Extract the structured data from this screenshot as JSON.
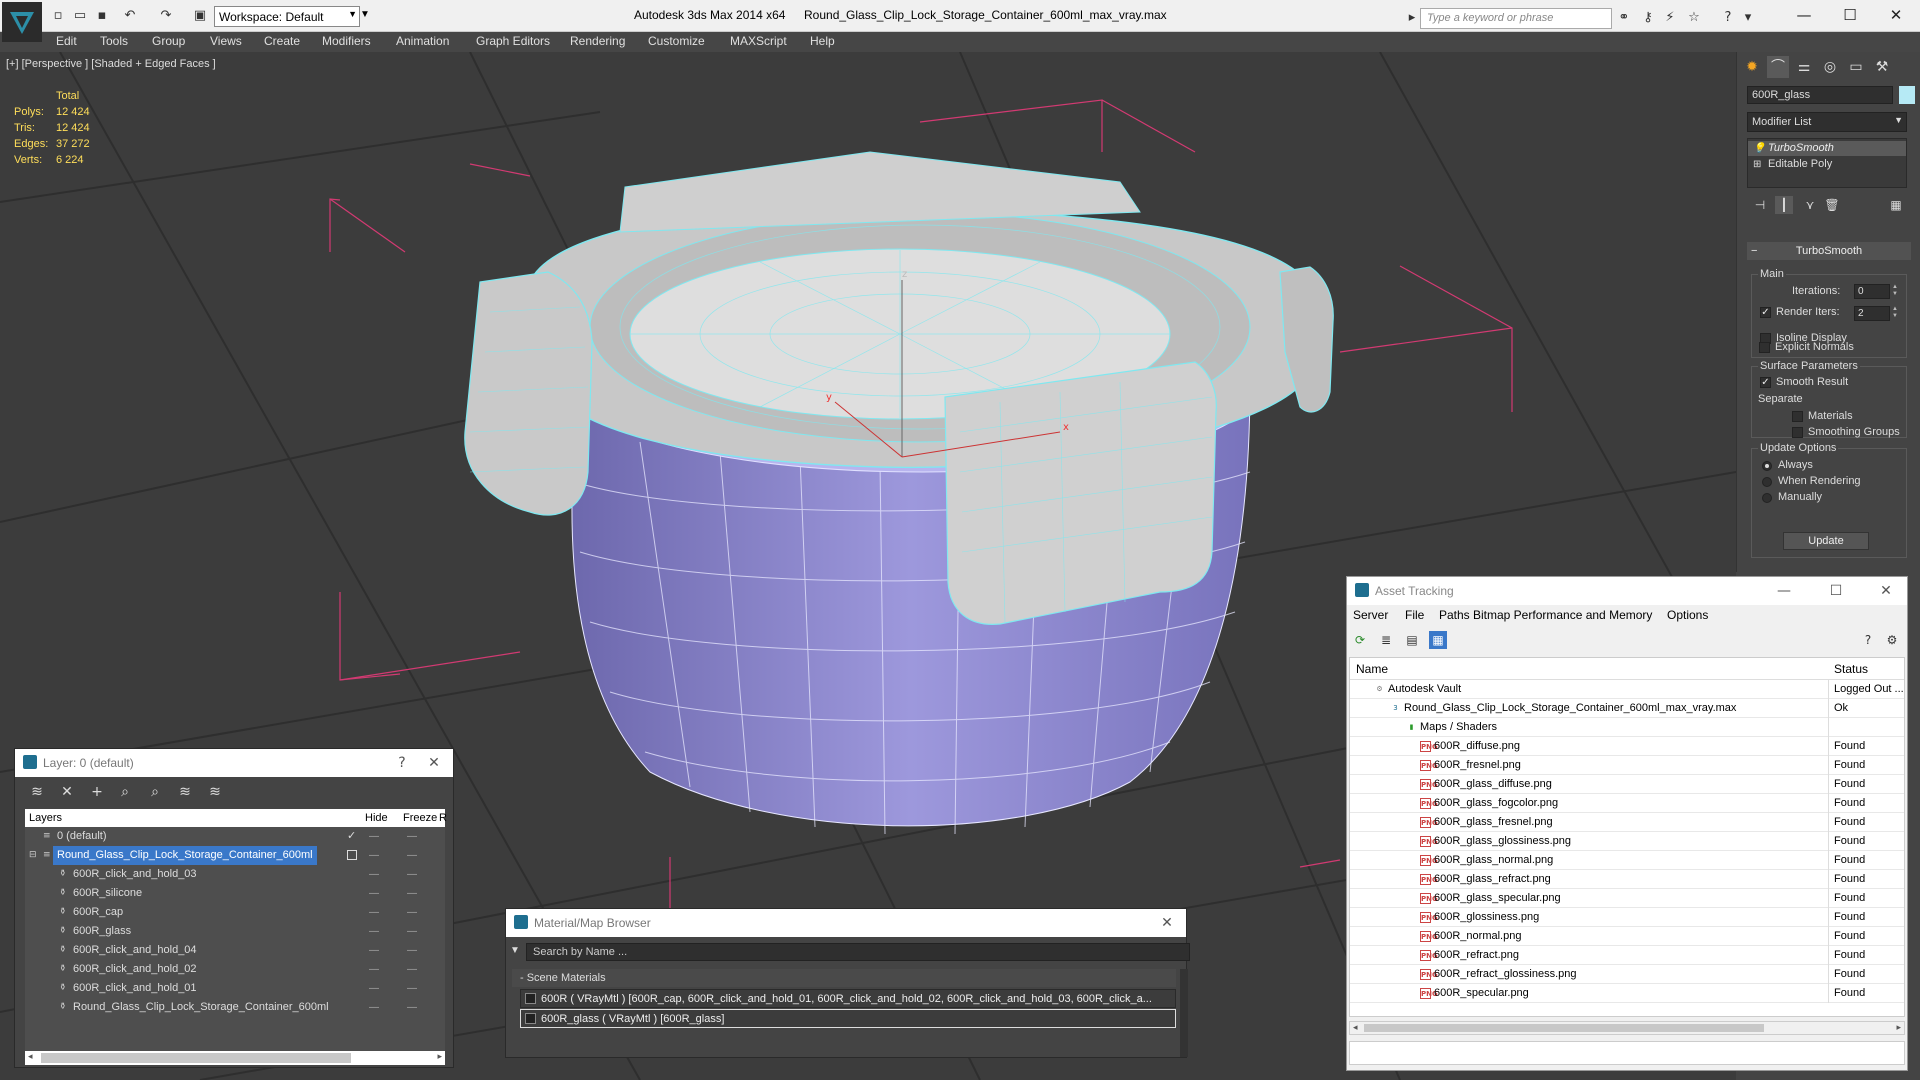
{
  "titlebar": {
    "workspace": "Workspace: Default",
    "app_title": "Autodesk 3ds Max  2014 x64",
    "file_title": "Round_Glass_Clip_Lock_Storage_Container_600ml_max_vray.max",
    "search_placeholder": "Type a keyword or phrase"
  },
  "menu": [
    "Edit",
    "Tools",
    "Group",
    "Views",
    "Create",
    "Modifiers",
    "Animation",
    "Graph Editors",
    "Rendering",
    "Customize",
    "MAXScript",
    "Help"
  ],
  "viewport": {
    "label": "[+] [Perspective ] [Shaded + Edged Faces ]",
    "stats": {
      "header": "Total",
      "rows": [
        {
          "label": "Polys:",
          "value": "12 424"
        },
        {
          "label": "Tris:",
          "value": "12 424"
        },
        {
          "label": "Edges:",
          "value": "37 272"
        },
        {
          "label": "Verts:",
          "value": "6 224"
        }
      ]
    },
    "axis_labels": {
      "z": "z",
      "y": "y",
      "x": "x"
    }
  },
  "command_panel": {
    "object_name": "600R_glass",
    "object_color": "#b6eaf5",
    "modifier_list": "Modifier List",
    "stack": [
      "TurboSmooth",
      "Editable Poly"
    ],
    "rollout_title": "TurboSmooth",
    "main_group": "Main",
    "iterations_label": "Iterations:",
    "iterations_value": "0",
    "render_iters_label": "Render Iters:",
    "render_iters_value": "2",
    "isoline_label": "Isoline Display",
    "explicit_normals_label": "Explicit Normals",
    "surface_group": "Surface Parameters",
    "smooth_result_label": "Smooth Result",
    "separate_label": "Separate",
    "materials_label": "Materials",
    "smoothing_groups_label": "Smoothing Groups",
    "update_group": "Update Options",
    "always_label": "Always",
    "when_rendering_label": "When Rendering",
    "manually_label": "Manually",
    "update_button": "Update"
  },
  "layer_dialog": {
    "title": "Layer: 0 (default)",
    "help": "?",
    "col_layers": "Layers",
    "col_hide": "Hide",
    "col_freeze": "Freeze",
    "col_r": "R",
    "rows": [
      {
        "name": "0 (default)",
        "indent": 0,
        "check": "✓"
      },
      {
        "name": "Round_Glass_Clip_Lock_Storage_Container_600ml",
        "indent": 0,
        "selected": true
      },
      {
        "name": "600R_click_and_hold_03",
        "indent": 1
      },
      {
        "name": "600R_silicone",
        "indent": 1
      },
      {
        "name": "600R_cap",
        "indent": 1
      },
      {
        "name": "600R_glass",
        "indent": 1
      },
      {
        "name": "600R_click_and_hold_04",
        "indent": 1
      },
      {
        "name": "600R_click_and_hold_02",
        "indent": 1
      },
      {
        "name": "600R_click_and_hold_01",
        "indent": 1
      },
      {
        "name": "Round_Glass_Clip_Lock_Storage_Container_600ml",
        "indent": 1
      }
    ]
  },
  "material_browser": {
    "title": "Material/Map Browser",
    "search_placeholder": "Search by Name ...",
    "group": "- Scene Materials",
    "rows": [
      "600R  ( VRayMtl )  [600R_cap, 600R_click_and_hold_01, 600R_click_and_hold_02, 600R_click_and_hold_03, 600R_click_a...",
      "600R_glass  ( VRayMtl )  [600R_glass]"
    ]
  },
  "asset_tracking": {
    "title": "Asset Tracking",
    "menu": [
      "Server",
      "File",
      "Paths",
      "Bitmap Performance and Memory",
      "Options"
    ],
    "col_name": "Name",
    "col_status": "Status",
    "rows": [
      {
        "name": "Autodesk Vault",
        "status": "Logged Out ...",
        "level": 0,
        "icon": "vault"
      },
      {
        "name": "Round_Glass_Clip_Lock_Storage_Container_600ml_max_vray.max",
        "status": "Ok",
        "level": 1,
        "icon": "max"
      },
      {
        "name": "Maps / Shaders",
        "status": "",
        "level": 2,
        "icon": "folder"
      },
      {
        "name": "600R_diffuse.png",
        "status": "Found",
        "level": 3,
        "icon": "png"
      },
      {
        "name": "600R_fresnel.png",
        "status": "Found",
        "level": 3,
        "icon": "png"
      },
      {
        "name": "600R_glass_diffuse.png",
        "status": "Found",
        "level": 3,
        "icon": "png"
      },
      {
        "name": "600R_glass_fogcolor.png",
        "status": "Found",
        "level": 3,
        "icon": "png"
      },
      {
        "name": "600R_glass_fresnel.png",
        "status": "Found",
        "level": 3,
        "icon": "png"
      },
      {
        "name": "600R_glass_glossiness.png",
        "status": "Found",
        "level": 3,
        "icon": "png"
      },
      {
        "name": "600R_glass_normal.png",
        "status": "Found",
        "level": 3,
        "icon": "png"
      },
      {
        "name": "600R_glass_refract.png",
        "status": "Found",
        "level": 3,
        "icon": "png"
      },
      {
        "name": "600R_glass_specular.png",
        "status": "Found",
        "level": 3,
        "icon": "png"
      },
      {
        "name": "600R_glossiness.png",
        "status": "Found",
        "level": 3,
        "icon": "png"
      },
      {
        "name": "600R_normal.png",
        "status": "Found",
        "level": 3,
        "icon": "png"
      },
      {
        "name": "600R_refract.png",
        "status": "Found",
        "level": 3,
        "icon": "png"
      },
      {
        "name": "600R_refract_glossiness.png",
        "status": "Found",
        "level": 3,
        "icon": "png"
      },
      {
        "name": "600R_specular.png",
        "status": "Found",
        "level": 3,
        "icon": "png"
      }
    ]
  },
  "colors": {
    "viewport_bg": "#3c3c3c",
    "stats_text": "#ffde5a",
    "wire": "#7fe8f0",
    "glass_body": "#8f8ad0",
    "lid": "#d8d8d8",
    "selection": "#3a78c9"
  }
}
